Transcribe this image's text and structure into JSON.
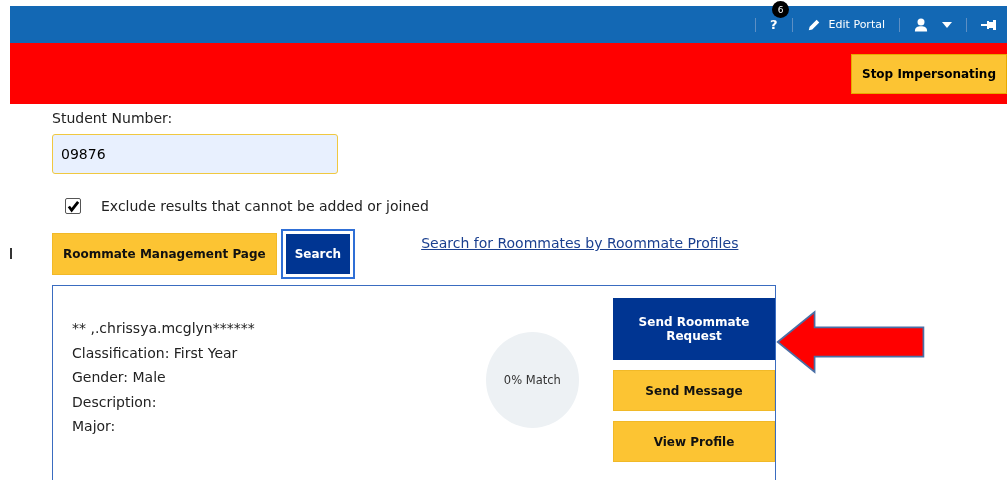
{
  "topbar": {
    "help": "?",
    "notification_count": "6",
    "edit_portal": "Edit Portal"
  },
  "impersonation_bar": {
    "button": "Stop Impersonating"
  },
  "form": {
    "student_number_label": "Student Number:",
    "student_number_value": "09876",
    "exclude": {
      "label": "Exclude results that cannot be added or joined",
      "checked": true
    },
    "buttons": [
      "Roommate Management Page",
      "Search"
    ],
    "profile_link": "Search for Roommates by Roommate Profiles"
  },
  "result": {
    "lines": [
      "** ,.chrissya.mcglyn******",
      "Classification: First Year",
      "Gender: Male",
      "Description:",
      "Major:"
    ],
    "match": "0% Match",
    "actions": [
      {
        "label": "Send Roommate Request",
        "kind": "primary"
      },
      {
        "label": "Send Message",
        "kind": "secondary"
      },
      {
        "label": "View Profile",
        "kind": "secondary"
      }
    ]
  }
}
